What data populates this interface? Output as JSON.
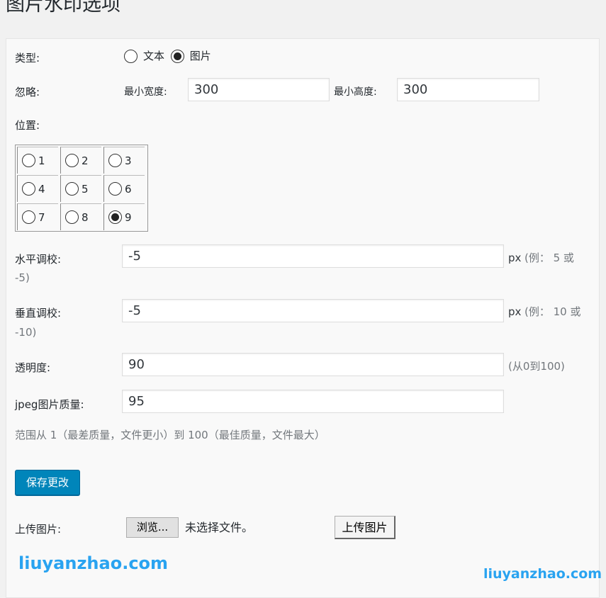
{
  "page": {
    "title": "图片水印选项"
  },
  "type": {
    "label": "类型:",
    "options": [
      {
        "label": "文本",
        "selected": false
      },
      {
        "label": "图片",
        "selected": true
      }
    ]
  },
  "ignore": {
    "label": "忽略:",
    "min_width_label": "最小宽度:",
    "min_width_value": "300",
    "min_height_label": "最小高度:",
    "min_height_value": "300"
  },
  "position": {
    "label": "位置:",
    "cells": [
      "1",
      "2",
      "3",
      "4",
      "5",
      "6",
      "7",
      "8",
      "9"
    ],
    "selected": "9"
  },
  "horizontal": {
    "label": "水平调校:",
    "value": "-5",
    "unit": "px",
    "hint": "(例： 5 或",
    "hint_cont": "-5)"
  },
  "vertical": {
    "label": "垂直调校:",
    "value": "-5",
    "unit": "px",
    "hint": "(例： 10 或",
    "hint_cont": "-10)"
  },
  "opacity": {
    "label": "透明度:",
    "value": "90",
    "hint": "(从0到100)"
  },
  "jpeg": {
    "label": "jpeg图片质量:",
    "value": "95",
    "description": "范围从 1（最差质量，文件更小）到 100（最佳质量，文件最大）"
  },
  "save_button": "保存更改",
  "upload": {
    "label": "上传图片:",
    "browse_button": "浏览...",
    "no_file_text": "未选择文件。",
    "upload_button": "上传图片"
  },
  "watermarks": [
    "liuyanzhao.com",
    "liuyanzhao.com"
  ],
  "colors": {
    "primary_button": "#0085ba",
    "watermark": "#29a3f0",
    "hint": "#72777c"
  }
}
